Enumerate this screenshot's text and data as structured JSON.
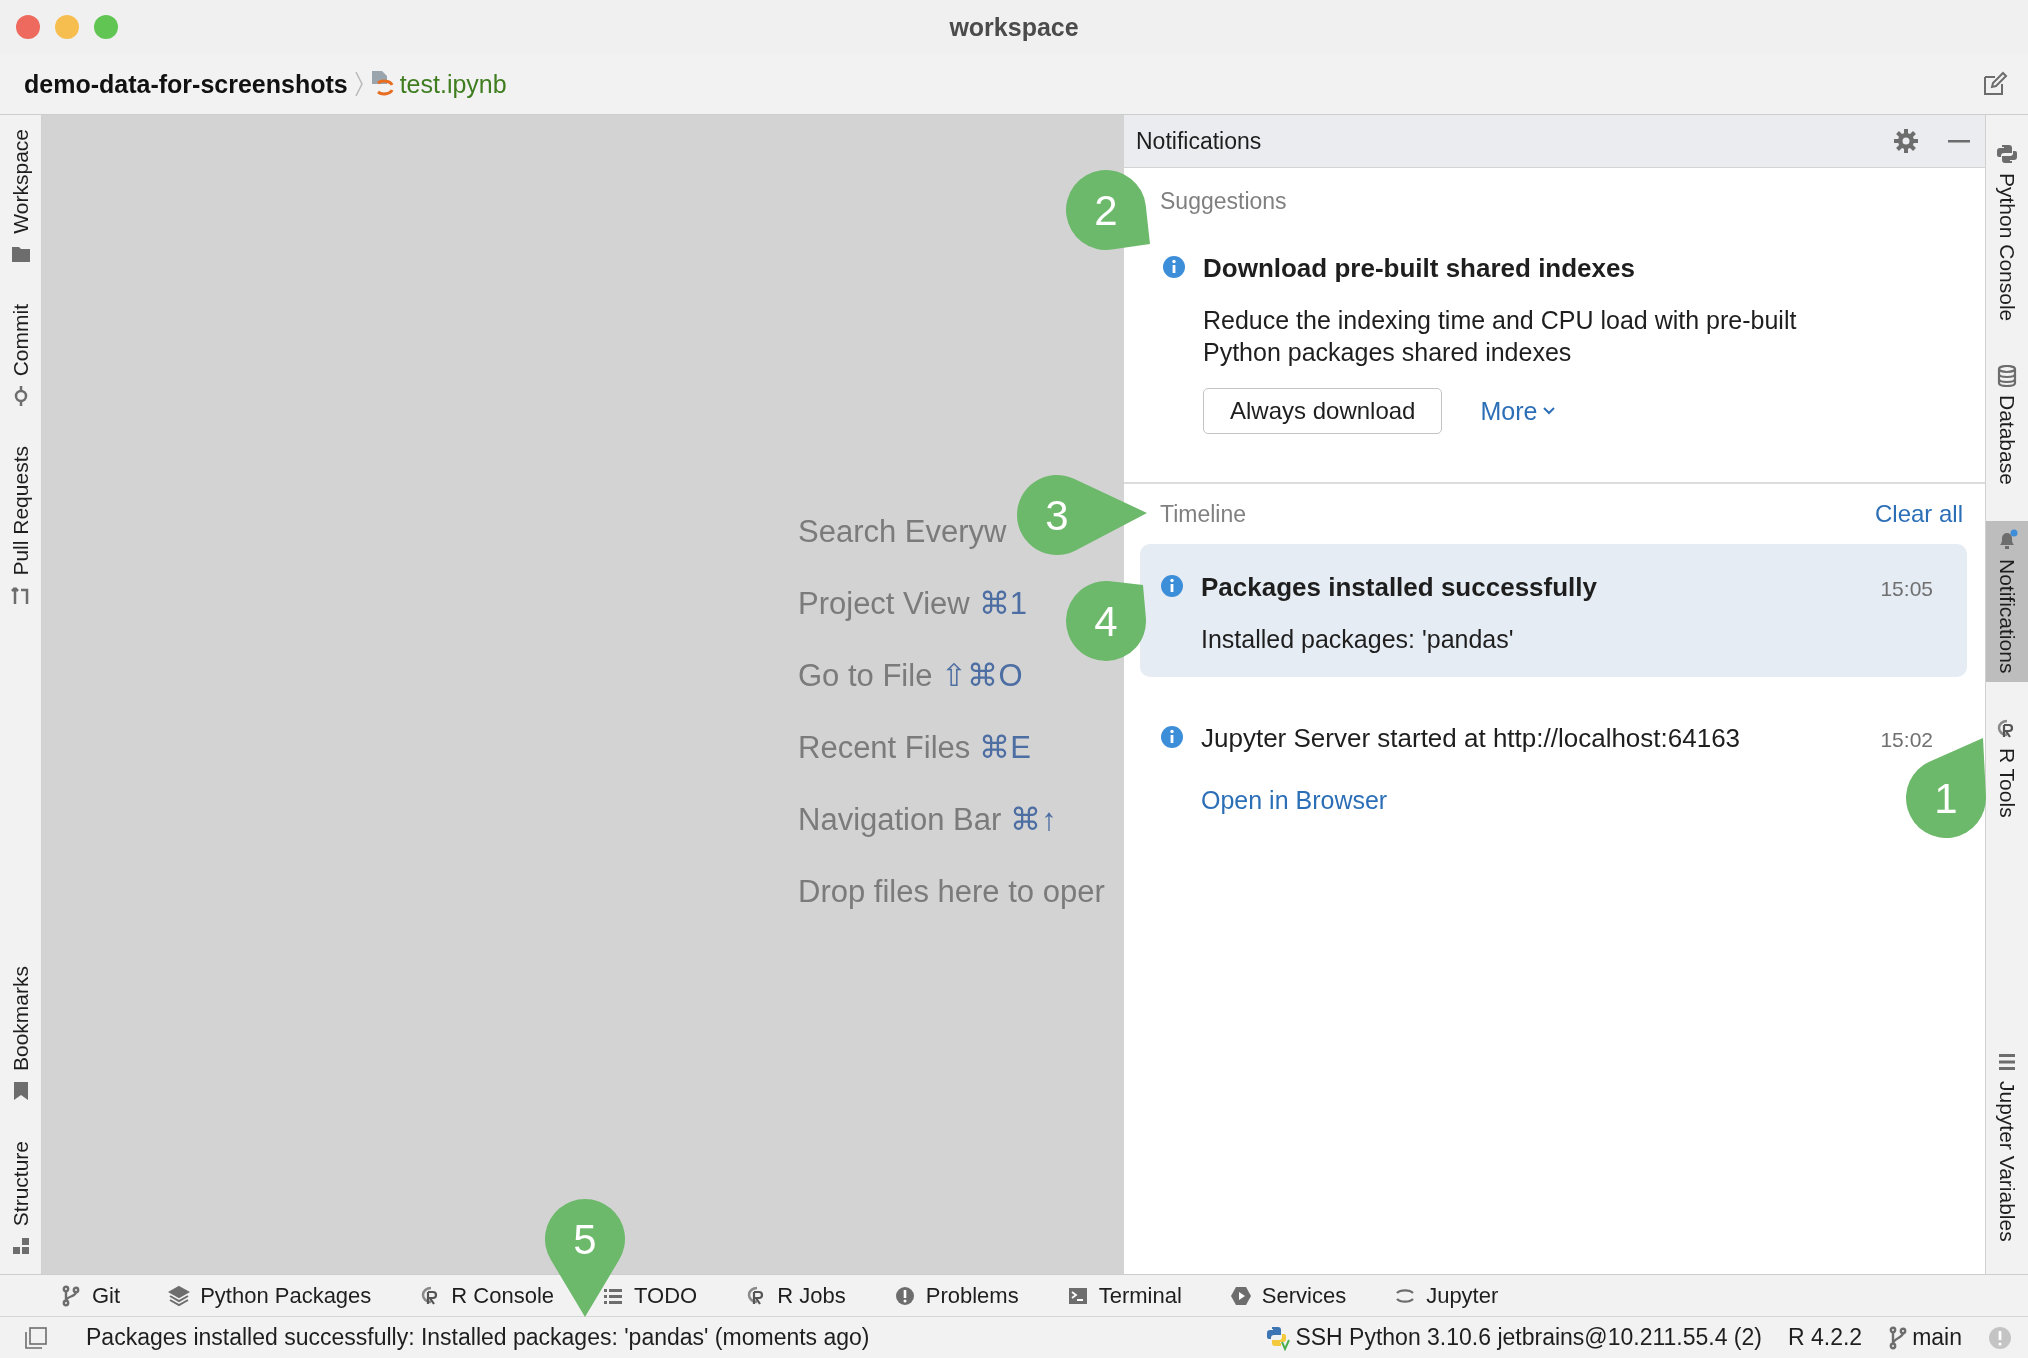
{
  "window": {
    "title": "workspace"
  },
  "breadcrumb": {
    "project": "demo-data-for-screenshots",
    "file": "test.ipynb"
  },
  "left_toolbar": {
    "top": [
      {
        "label": "Workspace",
        "kind": "folder"
      },
      {
        "label": "Commit",
        "kind": "commit"
      },
      {
        "label": "Pull Requests",
        "kind": "pull"
      }
    ],
    "bottom": [
      {
        "label": "Bookmarks",
        "kind": "bookmark"
      },
      {
        "label": "Structure",
        "kind": "structure"
      }
    ]
  },
  "editor_hints": [
    {
      "label": "Search Everyw"
    },
    {
      "label": "Project View",
      "shortcut": "⌘1"
    },
    {
      "label": "Go to File",
      "shortcut": "⇧⌘O"
    },
    {
      "label": "Recent Files",
      "shortcut": "⌘E"
    },
    {
      "label": "Navigation Bar",
      "shortcut": "⌘↑"
    },
    {
      "label": "Drop files here to oper"
    }
  ],
  "notifications": {
    "title": "Notifications",
    "suggestions": {
      "heading": "Suggestions",
      "items": [
        {
          "title": "Download pre-built shared indexes",
          "body": "Reduce the indexing time and CPU load with pre-built Python packages shared indexes",
          "button": "Always download",
          "link": "More"
        }
      ]
    },
    "timeline": {
      "heading": "Timeline",
      "clear": "Clear all",
      "items": [
        {
          "title": "Packages installed successfully",
          "unread": true,
          "selected": true,
          "time": "15:05",
          "body": "Installed packages: 'pandas'"
        },
        {
          "title": "Jupyter Server started at http://localhost:64163",
          "unread": false,
          "selected": false,
          "time": "15:02",
          "link": "Open in Browser"
        }
      ]
    }
  },
  "right_toolbar": {
    "top": [
      {
        "label": "Python Console",
        "kind": "python",
        "selected": false,
        "unread": false
      },
      {
        "label": "Database",
        "kind": "database",
        "selected": false,
        "unread": false
      },
      {
        "label": "Notifications",
        "kind": "bell",
        "selected": true,
        "unread": true
      },
      {
        "label": "R Tools",
        "kind": "r",
        "selected": false,
        "unread": false
      }
    ],
    "bottom": [
      {
        "label": "Jupyter Variables",
        "kind": "list",
        "selected": false,
        "unread": false
      }
    ]
  },
  "tool_windows": [
    {
      "label": "Git",
      "kind": "git"
    },
    {
      "label": "Python Packages",
      "kind": "layers"
    },
    {
      "label": "R Console",
      "kind": "r"
    },
    {
      "label": "TODO",
      "kind": "list"
    },
    {
      "label": "R Jobs",
      "kind": "r"
    },
    {
      "label": "Problems",
      "kind": "problem"
    },
    {
      "label": "Terminal",
      "kind": "terminal"
    },
    {
      "label": "Services",
      "kind": "services"
    },
    {
      "label": "Jupyter",
      "kind": "jupyter"
    }
  ],
  "status_bar": {
    "message": "Packages installed successfully: Installed packages: 'pandas' (moments ago)",
    "interpreter": "SSH Python 3.10.6 jetbrains@10.211.55.4 (2)",
    "r_version": "R 4.2.2",
    "branch": "main"
  },
  "callouts": [
    "1",
    "2",
    "3",
    "4",
    "5"
  ]
}
